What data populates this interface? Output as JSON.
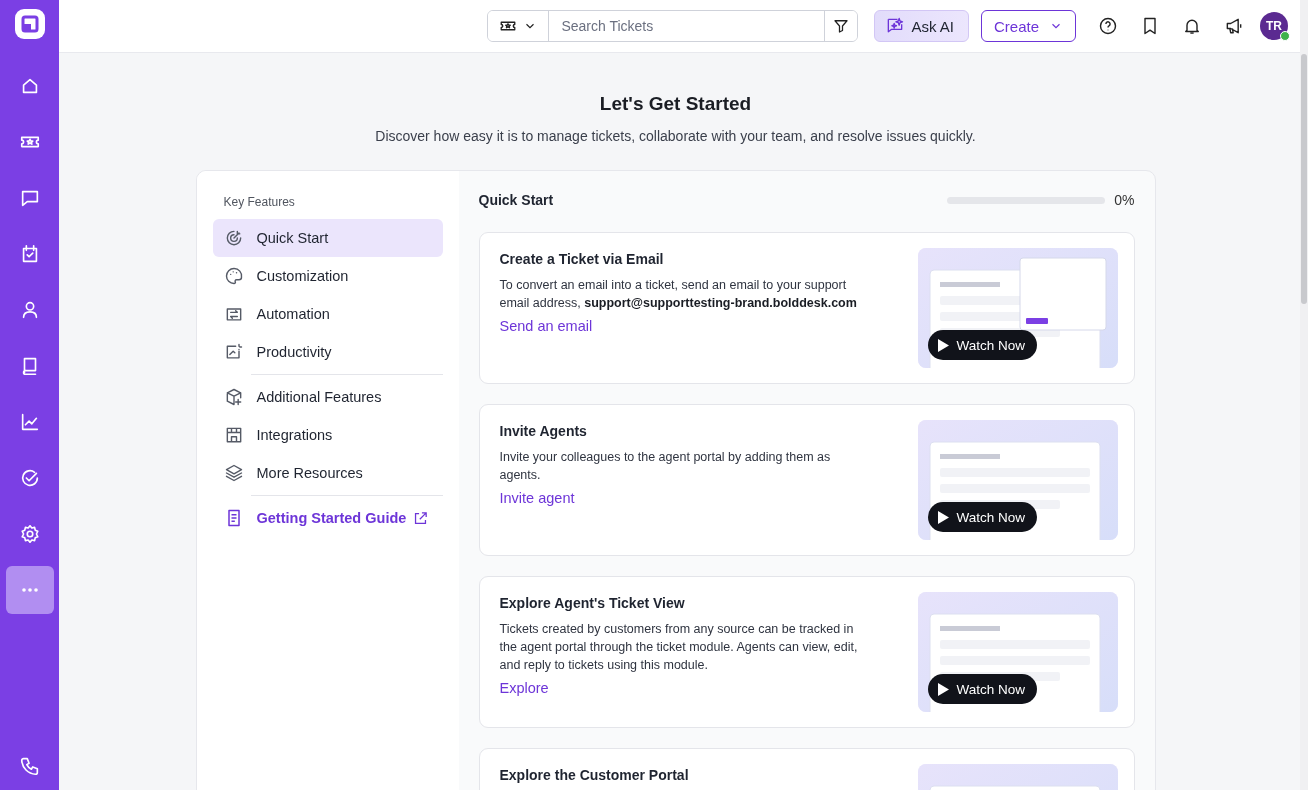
{
  "rail": {
    "items": [
      {
        "selected": false
      },
      {
        "selected": false
      },
      {
        "selected": false
      },
      {
        "selected": false
      },
      {
        "selected": false
      },
      {
        "selected": false
      },
      {
        "selected": false
      },
      {
        "selected": false
      },
      {
        "selected": false
      },
      {
        "selected": true
      }
    ]
  },
  "topbar": {
    "search": {
      "placeholder": "Search Tickets"
    },
    "ask_ai": "Ask AI",
    "create": "Create",
    "avatar": {
      "initials": "TR",
      "online": true
    }
  },
  "page": {
    "title": "Let's Get Started",
    "subtitle": "Discover how easy it is to manage tickets, collaborate with your team, and resolve issues quickly."
  },
  "nav": {
    "heading": "Key Features",
    "groups": [
      {
        "items": [
          {
            "label": "Quick Start",
            "selected": true
          },
          {
            "label": "Customization",
            "selected": false
          },
          {
            "label": "Automation",
            "selected": false
          },
          {
            "label": "Productivity",
            "selected": false
          }
        ]
      },
      {
        "items": [
          {
            "label": "Additional Features",
            "selected": false
          },
          {
            "label": "Integrations",
            "selected": false
          },
          {
            "label": "More Resources",
            "selected": false
          }
        ]
      }
    ],
    "guide_link": "Getting Started Guide"
  },
  "panel": {
    "title": "Quick Start",
    "progress": {
      "level": 0,
      "reading": "0%"
    },
    "cards": [
      {
        "title": "Create a Ticket via Email",
        "description": "To convert an email into a ticket, send an email to your support email address, **support@supporttesting-brand.bolddesk.com**",
        "link": "Send an email",
        "watch": "Watch Now"
      },
      {
        "title": "Invite Agents",
        "description": "Invite your colleagues to the agent portal by adding them as agents.",
        "link": "Invite agent",
        "watch": "Watch Now"
      },
      {
        "title": "Explore Agent's Ticket View",
        "description": "Tickets created by customers from any source can be tracked in the agent portal through the ticket module. Agents can view, edit, and reply to tickets using this module.",
        "link": "Explore",
        "watch": "Watch Now"
      },
      {
        "title": "Explore the Customer Portal"
      }
    ]
  }
}
